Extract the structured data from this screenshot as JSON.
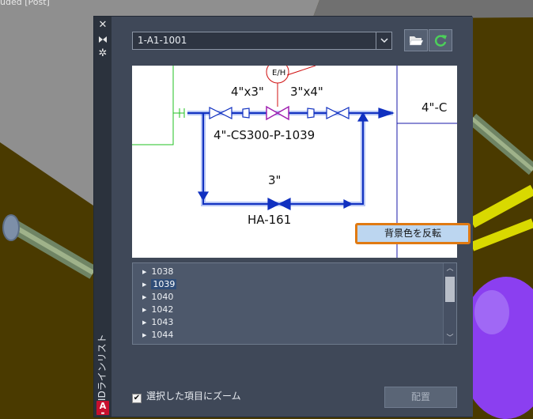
{
  "viewport": {
    "caption": "uded [Post]",
    "colors": {
      "ground": "#4a3a00",
      "pipe": "#7b8e6a",
      "purple": "#8b3ff0",
      "gray": "#8e8e8e",
      "yellow": "#f0f000"
    }
  },
  "palette": {
    "title": "P&IDラインリスト",
    "strip_icons": [
      "close-icon",
      "pin-icon",
      "gear-icon"
    ],
    "app_badge": "A",
    "drawing": {
      "selected": "1-A1-1001"
    },
    "tools": [
      "folder-open-icon",
      "refresh-icon"
    ],
    "preview": {
      "labels": {
        "eh": "E/H",
        "size_left": "4\"x3\"",
        "size_right": "3\"x4\"",
        "line_tag": "4\"-CS300-P-1039",
        "loop_size": "3\"",
        "valve_tag": "HA-161",
        "offsheet": "4\"-C"
      }
    },
    "invert_button": "背景色を反転",
    "lines": [
      {
        "label": "1038",
        "selected": false
      },
      {
        "label": "1039",
        "selected": true
      },
      {
        "label": "1040",
        "selected": false
      },
      {
        "label": "1042",
        "selected": false
      },
      {
        "label": "1043",
        "selected": false
      },
      {
        "label": "1044",
        "selected": false
      }
    ],
    "zoom_checkbox": {
      "label": "選択した項目にズーム",
      "checked": true
    },
    "place_button": "配置"
  }
}
